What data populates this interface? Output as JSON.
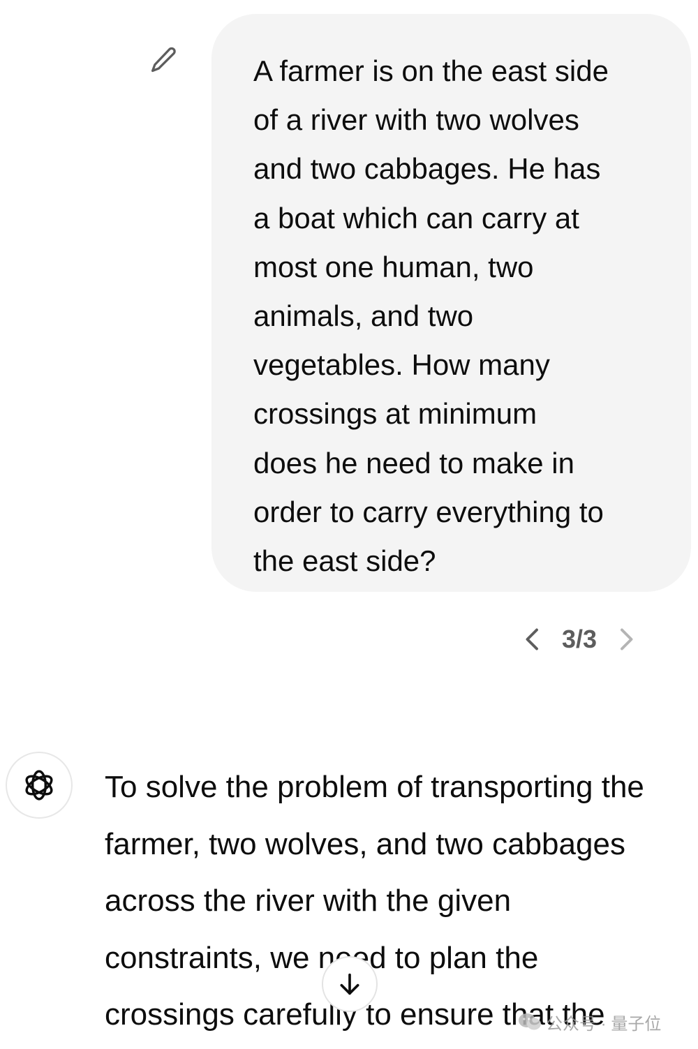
{
  "user_message": {
    "text": "A farmer is on the east side\nof a river with two wolves\nand two cabbages. He has\na boat which can carry at\nmost one human, two\nanimals, and two\nvegetables. How many\ncrossings at minimum\ndoes he need to make in\norder to carry everything to\nthe east side?",
    "edit_icon": "pencil-icon"
  },
  "pager": {
    "count": "3/3",
    "prev_icon": "chevron-left-icon",
    "next_icon": "chevron-right-icon"
  },
  "assistant_message": {
    "avatar_icon": "openai-logo-icon",
    "text": "To solve the problem of transporting the\nfarmer, two wolves, and two cabbages\nacross the river with the given\nconstraints, we need to plan the\ncrossings carefully to ensure that the"
  },
  "scroll_button": {
    "icon": "arrow-down-icon"
  },
  "watermark": {
    "text": "公众号 · 量子位"
  },
  "colors": {
    "bubble_bg": "#f4f4f4",
    "text": "#0d0d0d",
    "muted": "#5d5d5d"
  }
}
